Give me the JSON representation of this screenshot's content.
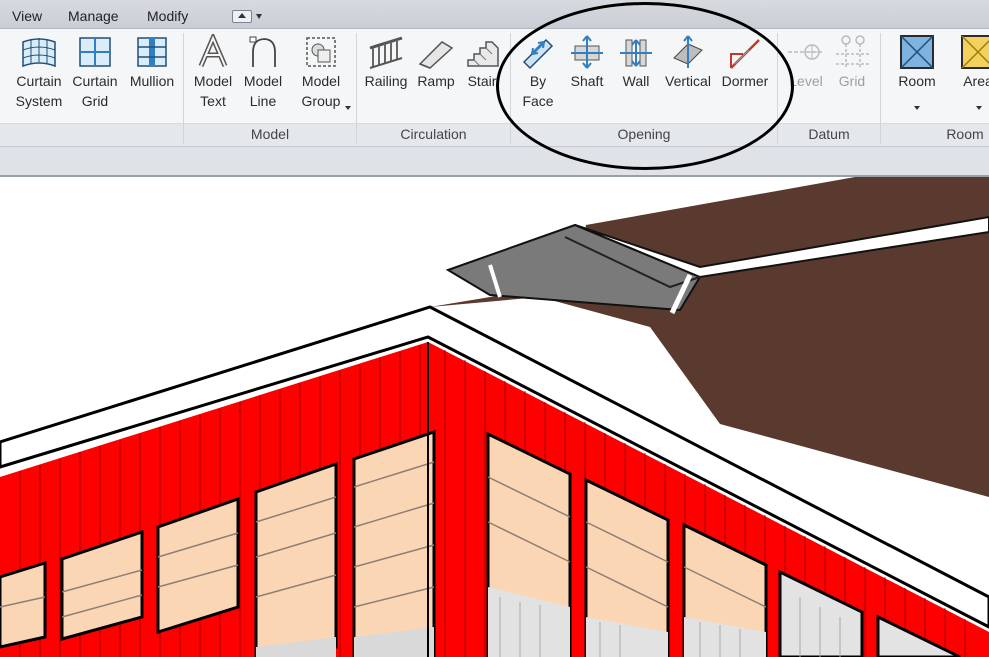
{
  "menu": {
    "items": [
      "View",
      "Manage",
      "Modify"
    ]
  },
  "ribbon": {
    "tools": {
      "curtain_system": [
        "Curtain",
        "System"
      ],
      "curtain_grid": [
        "Curtain",
        "Grid"
      ],
      "mullion": [
        "Mullion"
      ],
      "model_text": [
        "Model",
        "Text"
      ],
      "model_line": [
        "Model",
        "Line"
      ],
      "model_group": [
        "Model",
        "Group"
      ],
      "railing": [
        "Railing"
      ],
      "ramp": [
        "Ramp"
      ],
      "stair": [
        "Stair"
      ],
      "by_face": [
        "By",
        "Face"
      ],
      "shaft": [
        "Shaft"
      ],
      "wall": [
        "Wall"
      ],
      "vertical": [
        "Vertical"
      ],
      "dormer": [
        "Dormer"
      ],
      "level": [
        "Level"
      ],
      "grid": [
        "Grid"
      ],
      "room": [
        "Room"
      ],
      "area": [
        "Area"
      ]
    },
    "panels": {
      "model": "Model",
      "circulation": "Circulation",
      "opening": "Opening",
      "datum": "Datum",
      "room": "Room"
    }
  },
  "colors": {
    "wall_red": "#ff0000",
    "roof_brown": "#5a3a2e",
    "glass_peach": "#fbd6b5",
    "icon_blue": "#2f7fc2",
    "annotation": "#000000"
  }
}
